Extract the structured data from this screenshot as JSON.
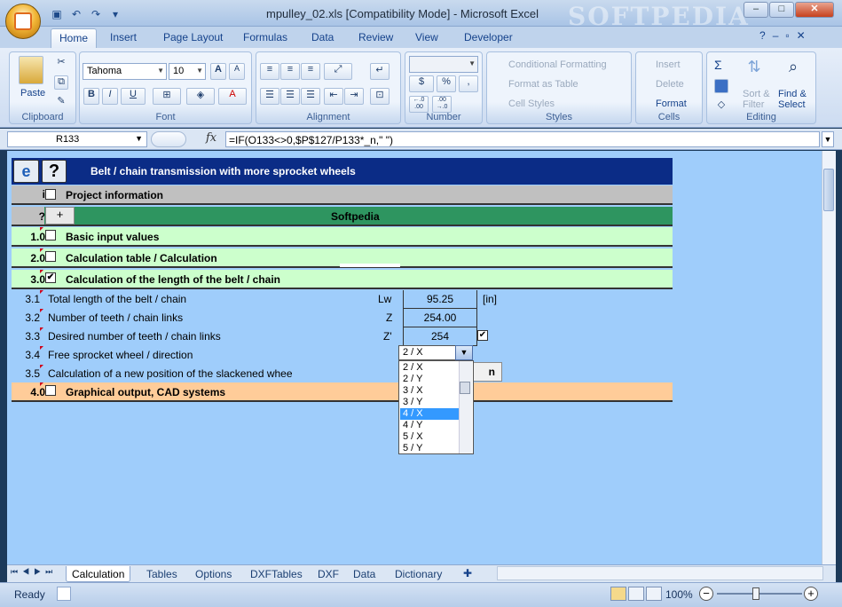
{
  "window": {
    "title": "mpulley_02.xls  [Compatibility Mode] - Microsoft Excel",
    "watermark": "SOFTPEDIA",
    "controls": {
      "minimize": "–",
      "maximize": "□",
      "close": "✕"
    }
  },
  "ribbon_tabs": [
    "Home",
    "Insert",
    "Page Layout",
    "Formulas",
    "Data",
    "Review",
    "View",
    "Developer"
  ],
  "ribbon": {
    "clipboard": {
      "label": "Clipboard",
      "paste": "Paste"
    },
    "font": {
      "label": "Font",
      "name": "Tahoma",
      "size": "10",
      "bold": "B",
      "italic": "I",
      "underline": "U",
      "grow": "A",
      "shrink": "A"
    },
    "alignment": {
      "label": "Alignment"
    },
    "number": {
      "label": "Number",
      "currency": "$",
      "percent": "%",
      "comma": ",",
      "inc_decimal": "←.0 .00",
      "dec_decimal": ".00 →.0"
    },
    "styles": {
      "label": "Styles",
      "conditional": "Conditional Formatting",
      "format_table": "Format as Table",
      "cell_styles": "Cell Styles"
    },
    "cells": {
      "label": "Cells",
      "insert": "Insert",
      "delete": "Delete",
      "format": "Format"
    },
    "editing": {
      "label": "Editing",
      "sum": "Σ",
      "sort": "Sort &",
      "filter": "Filter",
      "find": "Find &",
      "select": "Select"
    }
  },
  "formula_bar": {
    "name_box": "R133",
    "fx": "fx",
    "formula": "=IF(O133<>0,$P$127/P133*_n,\" \")"
  },
  "sheet": {
    "header_title": "Belt / chain transmission with more sprocket wheels",
    "header_icon_help": "?",
    "project_row": {
      "num": "i",
      "label": "Project information"
    },
    "softpedia_row": {
      "num": "?",
      "plus": "+",
      "label": "Softpedia"
    },
    "sections": [
      {
        "num": "1.0",
        "label": "Basic input values",
        "checked": ""
      },
      {
        "num": "2.0",
        "label": "Calculation table / Calculation",
        "checked": ""
      },
      {
        "num": "3.0",
        "label": "Calculation of the length of the belt / chain",
        "checked": "✔"
      }
    ],
    "rows": [
      {
        "num": "3.1",
        "label": "Total length of the belt / chain",
        "sym": "Lw",
        "value": "95.25",
        "unit": "[in]"
      },
      {
        "num": "3.2",
        "label": "Number of teeth / chain links",
        "sym": "Z",
        "value": "254.00",
        "unit": ""
      },
      {
        "num": "3.3",
        "label": "Desired number of teeth / chain links",
        "sym": "Z'",
        "value": "254",
        "unit": ""
      },
      {
        "num": "3.4",
        "label": "Free sprocket wheel / direction",
        "sym": "",
        "value": "",
        "unit": ""
      },
      {
        "num": "3.5",
        "label": "Calculation of a new position of the slackened whee",
        "sym": "",
        "value": "",
        "unit": ""
      }
    ],
    "row33_check": "✔",
    "section4": {
      "num": "4.0",
      "label": "Graphical output, CAD systems"
    },
    "hidden_button": "n"
  },
  "dropdown": {
    "selected": "2 / X",
    "options": [
      "2 / X",
      "2 / Y",
      "3 / X",
      "3 / Y",
      "4 / X",
      "4 / Y",
      "5 / X",
      "5 / Y"
    ],
    "highlighted_index": 4
  },
  "sheet_tabs": [
    "Calculation",
    "Tables",
    "Options",
    "DXFTables",
    "DXF",
    "Data",
    "Dictionary"
  ],
  "status": {
    "ready": "Ready",
    "zoom": "100%"
  }
}
